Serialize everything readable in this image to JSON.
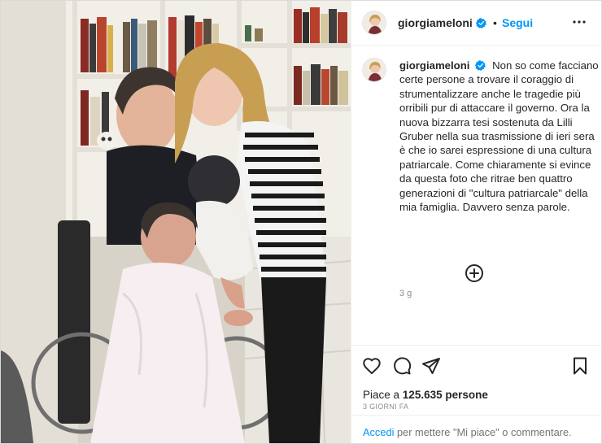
{
  "post": {
    "username": "giorgiameloni",
    "follow_label": "Segui",
    "separator": "•",
    "caption": "Non so come facciano certe persone a trovare il coraggio di strumentalizzare anche le tragedie più orribili pur di attaccare il governo. Ora la nuova bizzarra tesi sostenuta da Lilli Gruber nella sua trasmissione di ieri sera è che io sarei espressione di una cultura patriarcale. Come chiaramente si evince da questa foto che ritrae ben quattro generazioni di \"cultura patriarcale\" della mia famiglia. Davvero senza parole.",
    "caption_age": "3 g",
    "likes_prefix": "Piace a",
    "likes_count": "125.635",
    "likes_suffix": "persone",
    "post_date": "3 GIORNI FA",
    "login_link": "Accedi",
    "login_text": "per mettere \"Mi piace\" o commentare."
  },
  "icons": {
    "verified": "verified-badge-icon",
    "more": "more-options-icon",
    "add_comments": "plus-circle-icon",
    "like": "heart-icon",
    "comment": "comment-icon",
    "share": "share-icon",
    "save": "bookmark-icon"
  },
  "colors": {
    "accent": "#0095f6",
    "text": "#262626",
    "muted": "#8e8e8e",
    "verified": "#0095f6"
  }
}
